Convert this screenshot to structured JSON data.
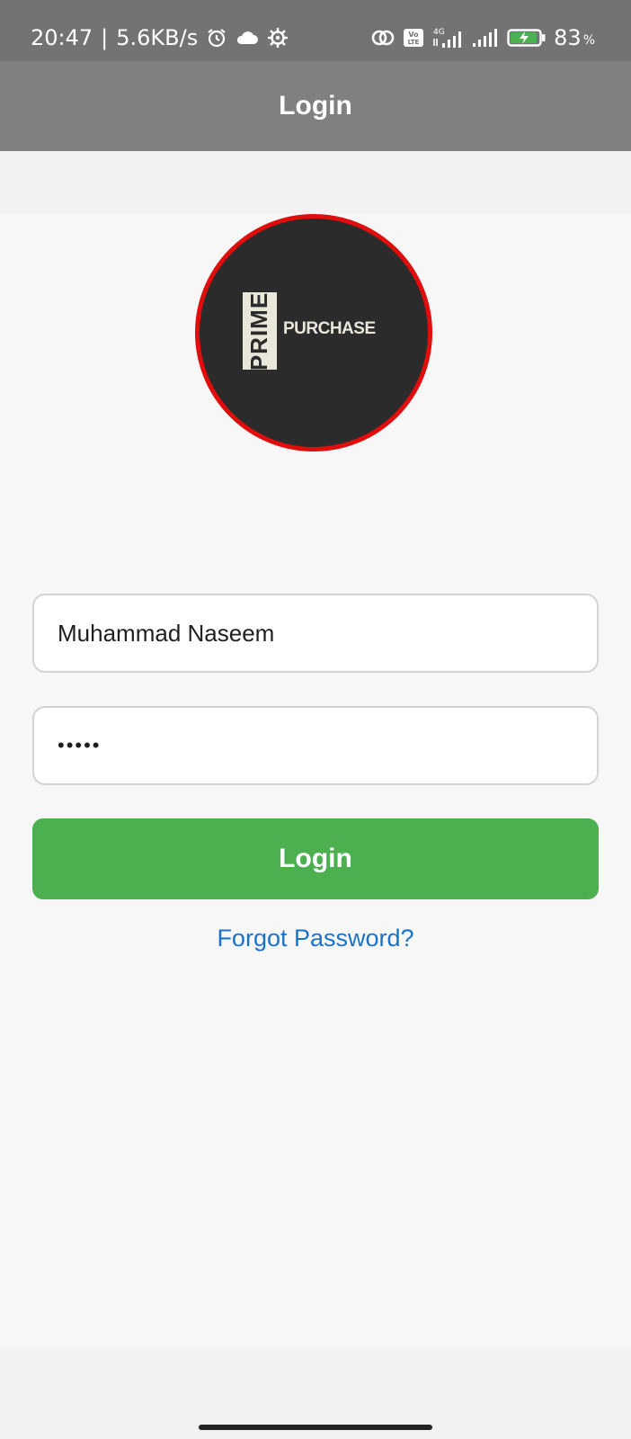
{
  "status_bar": {
    "time": "20:47",
    "separator": "|",
    "net_speed": "5.6KB/s",
    "battery_percent": "83",
    "battery_unit": "%",
    "network_label": "4G",
    "icons": [
      "alarm-icon",
      "cloud-icon",
      "settings-icon",
      "hotspot-icon",
      "volte-icon",
      "signal-4g-icon",
      "signal-icon",
      "battery-charging-icon"
    ]
  },
  "app_bar": {
    "title": "Login"
  },
  "logo": {
    "text_prime": "PRIME",
    "text_purchase": "PURCHASE"
  },
  "form": {
    "username_value": "Muhammad Naseem",
    "password_value": "•••••",
    "login_label": "Login",
    "forgot_label": "Forgot Password?"
  },
  "colors": {
    "status_bar": "#737373",
    "app_bar": "#808080",
    "login_button": "#4caf50",
    "link": "#1a73c8",
    "logo_ring": "#e00d0d",
    "logo_bg": "#2b2b2b"
  }
}
